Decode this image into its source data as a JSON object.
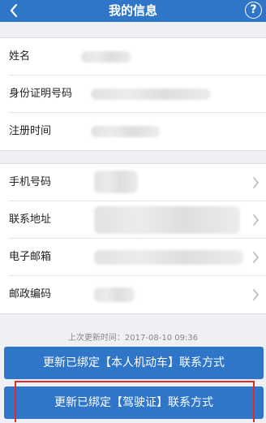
{
  "header": {
    "title": "我的信息",
    "back_icon": "chevron-left-icon",
    "help_label": "?"
  },
  "personal": {
    "name_label": "姓名",
    "id_label": "身份证明号码",
    "registered_label": "注册时间"
  },
  "contact": {
    "phone_label": "手机号码",
    "address_label": "联系地址",
    "email_label": "电子邮箱",
    "postcode_label": "邮政编码"
  },
  "footer": {
    "last_update": "上次更新时间：2017-08-10 09:36",
    "btn_vehicle": "更新已绑定【本人机动车】联系方式",
    "btn_license": "更新已绑定【驾驶证】联系方式"
  },
  "colors": {
    "primary": "#2f76c8",
    "highlight": "#e02a2a"
  }
}
